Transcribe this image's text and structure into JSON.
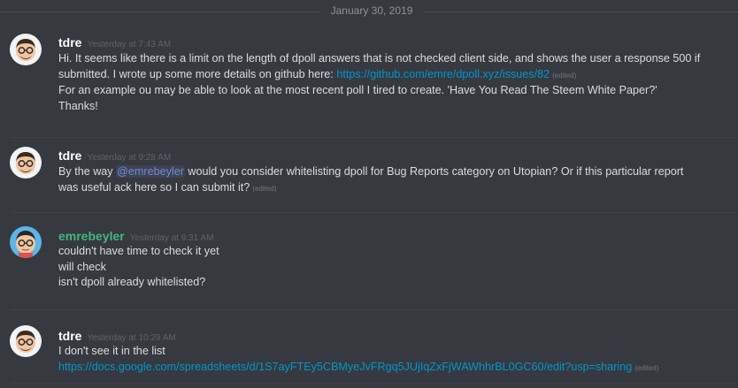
{
  "date_divider": "January 30, 2019",
  "edited_label": "(edited)",
  "messages": [
    {
      "author": "tdre",
      "timestamp": "Yesterday at 7:43 AM",
      "line1": "Hi.  It seems like there is a limit on the length of dpoll answers that is not checked client side, and shows the user a response 500 if",
      "line2_text": "submitted.  I wrote up some more details on github here: ",
      "line2_link": "https://github.com/emre/dpoll.xyz/issues/82",
      "line3": "For an example ou may be able to look at the most recent poll I tired to create. 'Have You Read The Steem White Paper?'",
      "line4": "Thanks!"
    },
    {
      "author": "tdre",
      "timestamp": "Yesterday at 9:28 AM",
      "line1_before": "By the way ",
      "mention": "@emrebeyler",
      "line1_after": " would you consider whitelisting dpoll for Bug Reports category on Utopian? Or if this particular report",
      "line2": "was useful ack here so I can submit it?"
    },
    {
      "author": "emrebeyler",
      "timestamp": "Yesterday at 9:31 AM",
      "lines": [
        "couldn't have time to check it yet",
        "will check",
        "isn't dpoll already whitelisted?"
      ]
    },
    {
      "author": "tdre",
      "timestamp": "Yesterday at 10:29 AM",
      "line1": "I don't see it in the list",
      "link": "https://docs.google.com/spreadsheets/d/1S7ayFTEy5CBMyeJvFRgq5JUjIqZxFjWAWhhrBL0GC60/edit?usp=sharing"
    }
  ]
}
